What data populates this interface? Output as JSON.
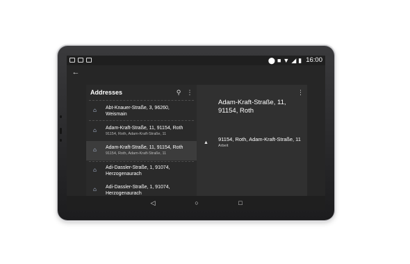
{
  "status_bar": {
    "time": "16:00",
    "left_icons": [
      "battery-saver-icon",
      "grid-icon",
      "image-icon"
    ],
    "right_icons": [
      "location-icon",
      "car-icon",
      "wifi-icon",
      "signal-icon",
      "battery-icon"
    ]
  },
  "header": {
    "title": "Addresses",
    "back_icon": "arrow-left-icon",
    "search_icon": "search-icon",
    "menu_icon": "more-vert-icon"
  },
  "list": {
    "items": [
      {
        "line1": "Abt-Knauer-Straße, 3, 96260,",
        "line2": "Weismain",
        "line2_style": "primary",
        "selected": false
      },
      {
        "line1": "Adam-Kraft-Straße, 11, 91154, Roth",
        "line2": "91154, Roth, Adam-Kraft-Straße, 11",
        "line2_style": "secondary",
        "selected": false
      },
      {
        "line1": "Adam-Kraft-Straße, 11, 91154, Roth",
        "line2": "91154, Roth, Adam-Kraft-Straße, 11",
        "line2_style": "secondary",
        "selected": true
      },
      {
        "line1": "Adi-Dassler-Straße, 1, 91074,",
        "line2": "Herzogenaurach",
        "line2_style": "primary",
        "selected": false
      },
      {
        "line1": "Adi-Dassler-Straße, 1, 91074,",
        "line2": "Herzogenaurach",
        "line2_style": "primary",
        "selected": false
      }
    ]
  },
  "detail": {
    "title": "Adam-Kraft-Straße, 11, 91154, Roth",
    "address": "91154, Roth, Adam-Kraft-Straße, 11",
    "tag": "Arbeit",
    "menu_icon": "more-vert-icon",
    "nav_icon": "navigation-arrow-icon"
  },
  "nav_bar": {
    "back_icon": "triangle-back-icon",
    "home_icon": "circle-home-icon",
    "recents_icon": "square-recents-icon"
  },
  "colors": {
    "screen_bg": "#262626",
    "list_bg": "#2a2a2a",
    "selected_row": "#3c3c3c",
    "detail_bg": "#303030",
    "home_icon": "#cfe0ff"
  }
}
